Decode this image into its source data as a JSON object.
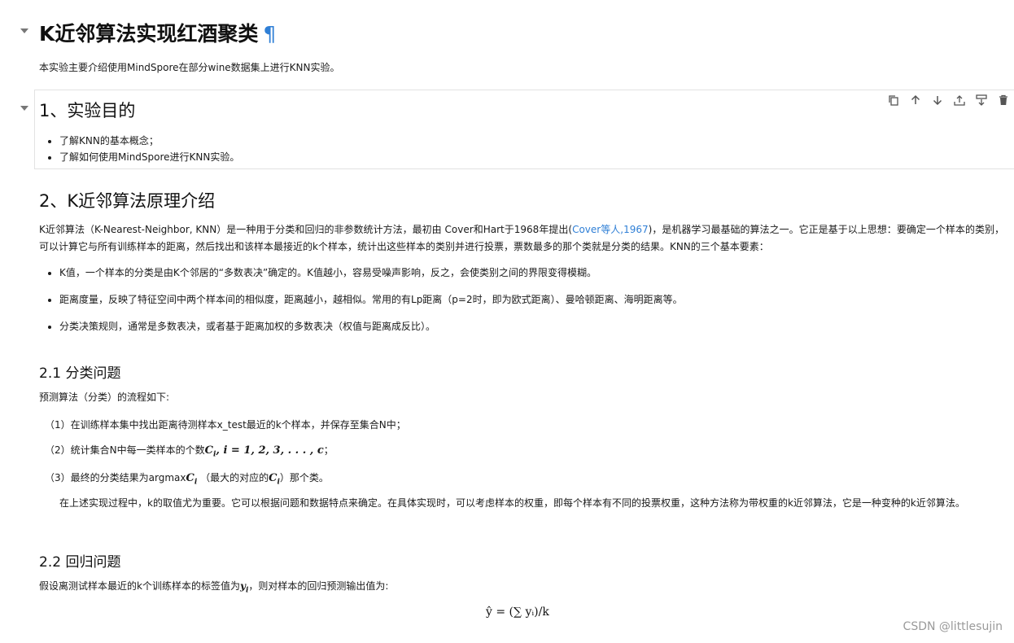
{
  "title": {
    "text": "K近邻算法实现红酒聚类",
    "anchor": "¶"
  },
  "intro": "本实验主要介绍使用MindSpore在部分wine数据集上进行KNN实验。",
  "section1": {
    "heading": "1、实验目的",
    "items": [
      "了解KNN的基本概念；",
      "了解如何使用MindSpore进行KNN实验。"
    ]
  },
  "cell_toolbar": [
    "duplicate-icon",
    "move-up-icon",
    "move-down-icon",
    "insert-above-icon",
    "insert-below-icon",
    "delete-icon"
  ],
  "section2": {
    "heading": "2、K近邻算法原理介绍",
    "para_before_link": "K近邻算法（K-Nearest-Neighbor, KNN）是一种用于分类和回归的非参数统计方法，最初由 Cover和Hart于1968年提出(",
    "link": "Cover等人,1967",
    "para_after_link": ")，是机器学习最基础的算法之一。它正是基于以上思想：要确定一个样本的类别，可以计算它与所有训练样本的距离，然后找出和该样本最接近的k个样本，统计出这些样本的类别并进行投票，票数最多的那个类就是分类的结果。KNN的三个基本要素：",
    "elements": [
      "K值，一个样本的分类是由K个邻居的“多数表决”确定的。K值越小，容易受噪声影响，反之，会使类别之间的界限变得模糊。",
      "距离度量，反映了特征空间中两个样本间的相似度，距离越小，越相似。常用的有Lp距离（p=2时，即为欧式距离）、曼哈顿距离、海明距离等。",
      "分类决策规则，通常是多数表决，或者基于距离加权的多数表决（权值与距离成反比）。"
    ]
  },
  "section21": {
    "heading": "2.1 分类问题",
    "intro": "预测算法（分类）的流程如下:",
    "step1": "（1）在训练样本集中找出距离待测样本x_test最近的k个样本，并保存至集合N中；",
    "step2_text": "（2）统计集合N中每一类样本的个数",
    "step2_math": "C",
    "step2_math_tail": ", i = 1, 2, 3, . . . , c",
    "step2_end": "；",
    "step3_text": "（3）最终的分类结果为argmax",
    "step3_math": "C",
    "step3_mid": " （最大的对应的",
    "step3_end": "）那个类。",
    "note": "在上述实现过程中，k的取值尤为重要。它可以根据问题和数据特点来确定。在具体实现时，可以考虑样本的权重，即每个样本有不同的投票权重，这种方法称为带权重的k近邻算法，它是一种变种的k近邻算法。"
  },
  "section22": {
    "heading": "2.2 回归问题",
    "intro_text": "假设离测试样本最近的k个训练样本的标签值为",
    "intro_math": "y",
    "intro_end": "，则对样本的回归预测输出值为:",
    "formula": "ŷ = (∑ yᵢ)/k"
  },
  "watermark": "CSDN @littlesujin"
}
